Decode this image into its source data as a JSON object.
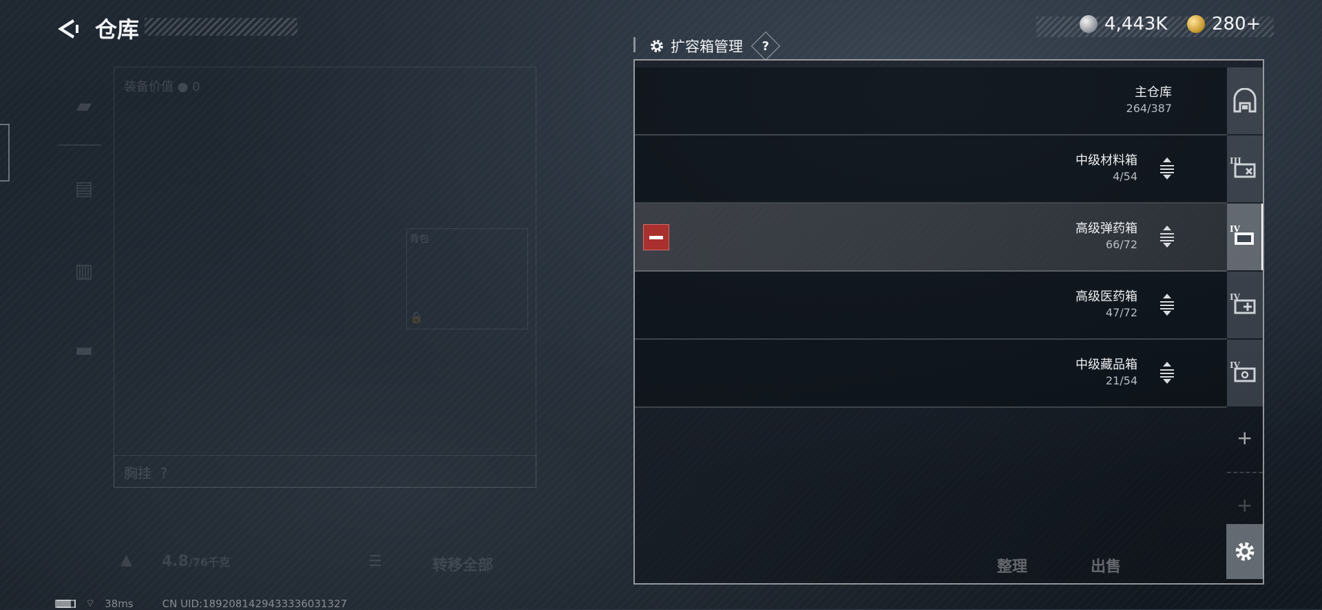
{
  "header": {
    "title": "仓库",
    "currency_silver": "4,443K",
    "currency_gold": "280+"
  },
  "left_panel": {
    "equipment_value_label": "装备价值",
    "equipment_value": "0",
    "backpack_label": "背包",
    "chest_rig_label": "胸挂",
    "chest_rig_help": "?",
    "weight": "4.8",
    "weight_capacity": "/76千克",
    "transfer_all_label": "转移全部"
  },
  "manager": {
    "title": "扩容箱管理",
    "help": "?",
    "rows": [
      {
        "name": "主仓库",
        "count": "264/387"
      },
      {
        "name": "中级材料箱",
        "count": "4/54",
        "tier": "III"
      },
      {
        "name": "高级弹药箱",
        "count": "66/72",
        "tier": "IV"
      },
      {
        "name": "高级医药箱",
        "count": "47/72",
        "tier": "IV"
      },
      {
        "name": "中级藏品箱",
        "count": "21/54",
        "tier": "IV"
      }
    ],
    "add_symbol": "+",
    "sort_label": "整理",
    "sell_label": "出售"
  },
  "status_bar": {
    "ping": "38ms",
    "uid": "CN UID:1892081429433336031327"
  }
}
